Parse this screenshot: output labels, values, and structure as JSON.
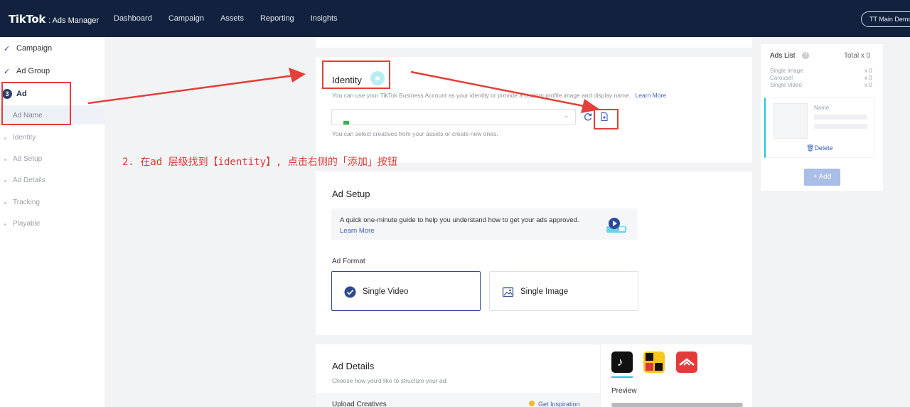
{
  "topbar": {
    "logo_main": "TikTok",
    "logo_sub": ": Ads Manager",
    "nav": [
      "Dashboard",
      "Campaign",
      "Assets",
      "Reporting",
      "Insights"
    ],
    "account": "TT Main Demo"
  },
  "sidebar": {
    "campaign": "Campaign",
    "ad_group": "Ad Group",
    "ad_step": "3",
    "ad": "Ad",
    "subitems": [
      "Ad Name",
      "Identity",
      "Ad Setup",
      "Ad Details",
      "Tracking",
      "Playable"
    ]
  },
  "identity": {
    "title": "Identity",
    "desc": "You can use your TikTok Business Account as your identity or provide a custom profile image and display name.",
    "learn_more": "Learn More",
    "hint": "You can select creatives from your assets or create new ones."
  },
  "ad_setup": {
    "title": "Ad Setup",
    "guide": "A quick one-minute guide to help you understand how to get your ads approved.",
    "guide_link": "Learn More",
    "format_label": "Ad Format",
    "single_video": "Single Video",
    "single_image": "Single Image"
  },
  "ad_details": {
    "title": "Ad Details",
    "desc": "Choose how you'd like to structure your ad.",
    "upload": "Upload Creatives",
    "inspiration": "Get Inspiration",
    "preview": "Preview"
  },
  "ads_list": {
    "title": "Ads List",
    "total": "Total x 0",
    "rows": [
      {
        "label": "Single Image",
        "count": "x 0"
      },
      {
        "label": "Carousel",
        "count": "x 0"
      },
      {
        "label": "Single Video",
        "count": "x 0"
      }
    ],
    "name_label": "Name",
    "delete": "Delete",
    "add": "+ Add"
  },
  "annotation": {
    "text": "2. 在ad 层级找到【identity】, 点击右侧的「添加」按钮"
  },
  "colors": {
    "topbar": "#12223e",
    "annotation": "#e2403a",
    "accent": "#2f4a8a",
    "add_button": "#a9bde6"
  }
}
